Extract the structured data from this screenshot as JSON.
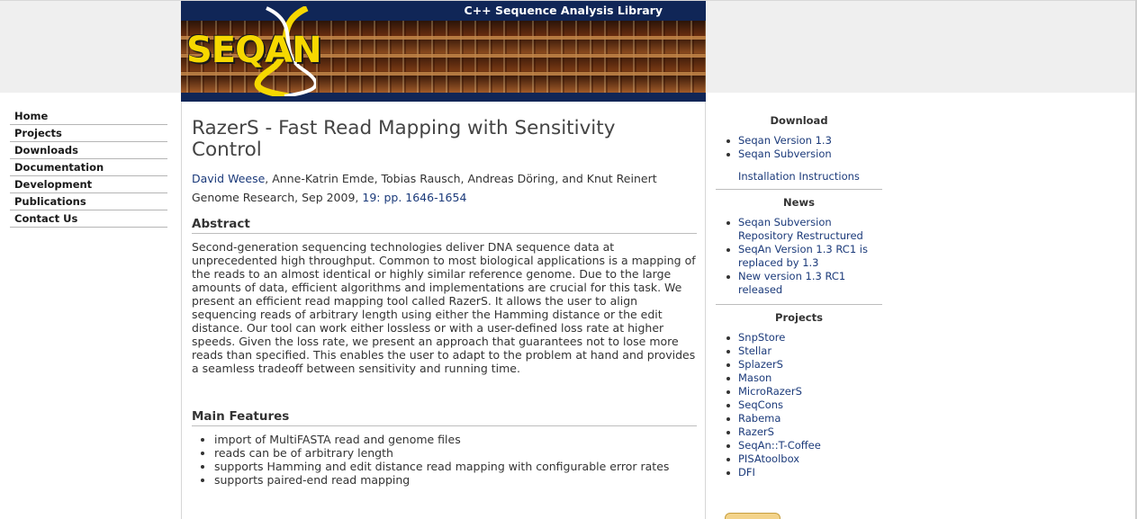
{
  "header": {
    "subtitle": "C++ Sequence Analysis Library",
    "logo_text": "SEQAN"
  },
  "nav": {
    "items": [
      "Home",
      "Projects",
      "Downloads",
      "Documentation",
      "Development",
      "Publications",
      "Contact Us"
    ]
  },
  "article": {
    "title": "RazerS - Fast Read Mapping with Sensitivity Control",
    "author_link": "David Weese",
    "authors_rest": ", Anne-Katrin Emde, Tobias Rausch, Andreas Döring, and Knut Reinert",
    "journal_text": "Genome Research, Sep 2009, ",
    "journal_link": "19: pp. 1646-1654",
    "abstract_heading": "Abstract",
    "abstract": "Second-generation sequencing technologies deliver DNA sequence data at unprecedented high throughput. Common to most biological applications is a mapping of the reads to an almost identical or highly similar reference genome. Due to the large amounts of data, efficient algorithms and implementations are crucial for this task. We present an efficient read mapping tool called RazerS. It allows the user to align sequencing reads of arbitrary length using either the Hamming distance or the edit distance. Our tool can work either lossless or with a user-defined loss rate at higher speeds. Given the loss rate, we present an approach that guarantees not to lose more reads than specified. This enables the user to adapt to the problem at hand and provides a seamless tradeoff between sensitivity and running time.",
    "features_heading": "Main Features",
    "features": [
      "import of MultiFASTA read and genome files",
      "reads can be of arbitrary length",
      "supports Hamming and edit distance read mapping with configurable error rates",
      "supports paired-end read mapping"
    ]
  },
  "sidebar": {
    "download_heading": "Download",
    "download_items": [
      "Seqan Version 1.3",
      "Seqan Subversion"
    ],
    "install_link": "Installation Instructions",
    "news_heading": "News",
    "news_items": [
      "Seqan Subversion Repository Restructured",
      "SeqAn Version 1.3 RC1 is replaced by 1.3",
      "New version 1.3 RC1 released"
    ],
    "projects_heading": "Projects",
    "project_items": [
      "SnpStore",
      "Stellar",
      "SplazerS",
      "Mason",
      "MicroRazerS",
      "SeqCons",
      "Rabema",
      "RazerS",
      "SeqAn::T-Coffee",
      "PISAtoolbox",
      "DFI"
    ]
  },
  "colors": {
    "header_navy": "#102657",
    "link_blue": "#1b3a7a",
    "logo_yellow": "#f6d800"
  }
}
